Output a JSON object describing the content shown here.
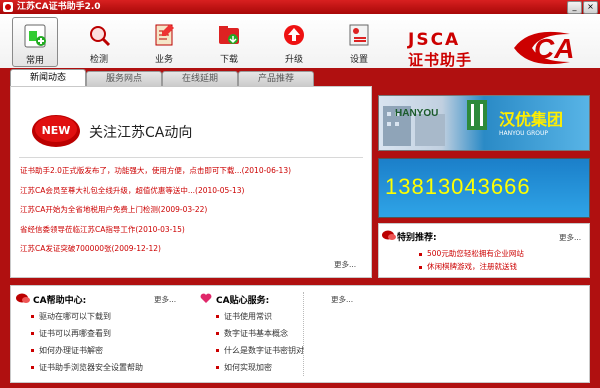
{
  "window": {
    "title": "江苏CA证书助手2.0"
  },
  "toolbar": {
    "items": [
      {
        "label": "常用",
        "icon": "home-icon"
      },
      {
        "label": "检测",
        "icon": "magnifier-icon"
      },
      {
        "label": "业务",
        "icon": "notepad-icon"
      },
      {
        "label": "下载",
        "icon": "download-folder-icon"
      },
      {
        "label": "升级",
        "icon": "upgrade-icon"
      },
      {
        "label": "设置",
        "icon": "settings-icon"
      }
    ]
  },
  "brand": {
    "latin": "JSCA",
    "chinese": "证书助手",
    "logo": "CA"
  },
  "tabs": [
    "新闻动态",
    "服务网点",
    "在线延期",
    "产品推荐"
  ],
  "news": {
    "badge": "NEW",
    "title": "关注江苏CA动向",
    "items": [
      {
        "text": "证书助手2.0正式版发布了，功能强大，使用方便，点击即可下载",
        "date": "...(2010-06-13)"
      },
      {
        "text": "江苏CA会员至尊大礼包全线升级，超值优惠等送中",
        "date": "...(2010-05-13)"
      },
      {
        "text": "江苏CA开始为全省地税用户免费上门检测",
        "date": "(2009-03-22)"
      },
      {
        "text": "省经信委领导莅临江苏CA指导工作",
        "date": "(2010-03-15)"
      },
      {
        "text": "江苏CA发证突破700000张",
        "date": "(2009-12-12)"
      }
    ],
    "more": "更多..."
  },
  "ads": {
    "banner1": {
      "logo_text": "HANYOU",
      "slogan": "汉优集团",
      "sub": "HANYOU GROUP"
    },
    "banner2": {
      "phone": "13813043666"
    },
    "special": {
      "title": "特别推荐:",
      "items": [
        "500元助您轻松拥有企业网站",
        "休闲棋牌游戏，注册就送钱"
      ],
      "more": "更多..."
    }
  },
  "help": {
    "title": "CA帮助中心:",
    "more": "更多...",
    "items": [
      "驱动在哪可以下载到",
      "证书可以再哪查看到",
      "如何办理证书解密",
      "证书助手浏览器安全设置帮助"
    ]
  },
  "care": {
    "title": "CA贴心服务:",
    "more": "更多...",
    "items": [
      "证书使用常识",
      "数字证书基本概念",
      "什么是数字证书密钥对",
      "如何实现加密"
    ]
  },
  "colors": {
    "brand_red": "#cc0000",
    "frame_red": "#b01010",
    "banner_phone": "#ffff00"
  }
}
